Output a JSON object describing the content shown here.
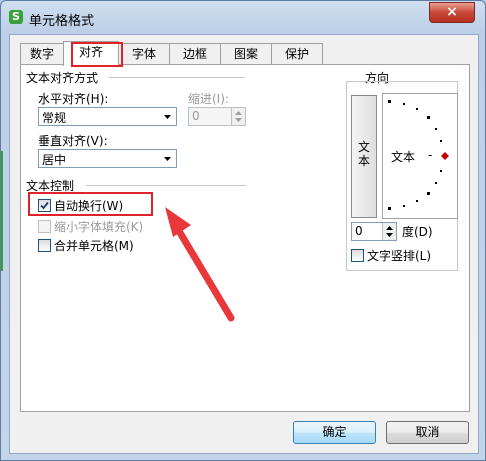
{
  "window": {
    "title": "单元格格式",
    "app_icon": "S",
    "close_label": "×"
  },
  "tabs": [
    "数字",
    "对齐",
    "字体",
    "边框",
    "图案",
    "保护"
  ],
  "active_tab": "对齐",
  "alignment": {
    "section_title": "文本对齐方式",
    "horizontal_label": "水平对齐(H):",
    "horizontal_value": "常规",
    "indent_label": "缩进(I):",
    "indent_value": "0",
    "vertical_label": "垂直对齐(V):",
    "vertical_value": "居中"
  },
  "text_control": {
    "section_title": "文本控制",
    "wrap_text": {
      "label": "自动换行(W)",
      "checked": true
    },
    "shrink_to_fit": {
      "label": "缩小字体填充(K)",
      "checked": false,
      "disabled": true
    },
    "merge_cells": {
      "label": "合并单元格(M)",
      "checked": false
    }
  },
  "orientation": {
    "section_title": "方向",
    "vertical_text_button": "文本",
    "dial_text": "文本",
    "dial_dash": "-",
    "degree_value": "0",
    "degree_label": "度(D)",
    "vertical_text_checkbox": {
      "label": "文字竖排(L)",
      "checked": false
    }
  },
  "buttons": {
    "ok": "确定",
    "cancel": "取消"
  },
  "colors": {
    "annotation_red": "#e0232a",
    "dial_marker": "#c00000"
  }
}
